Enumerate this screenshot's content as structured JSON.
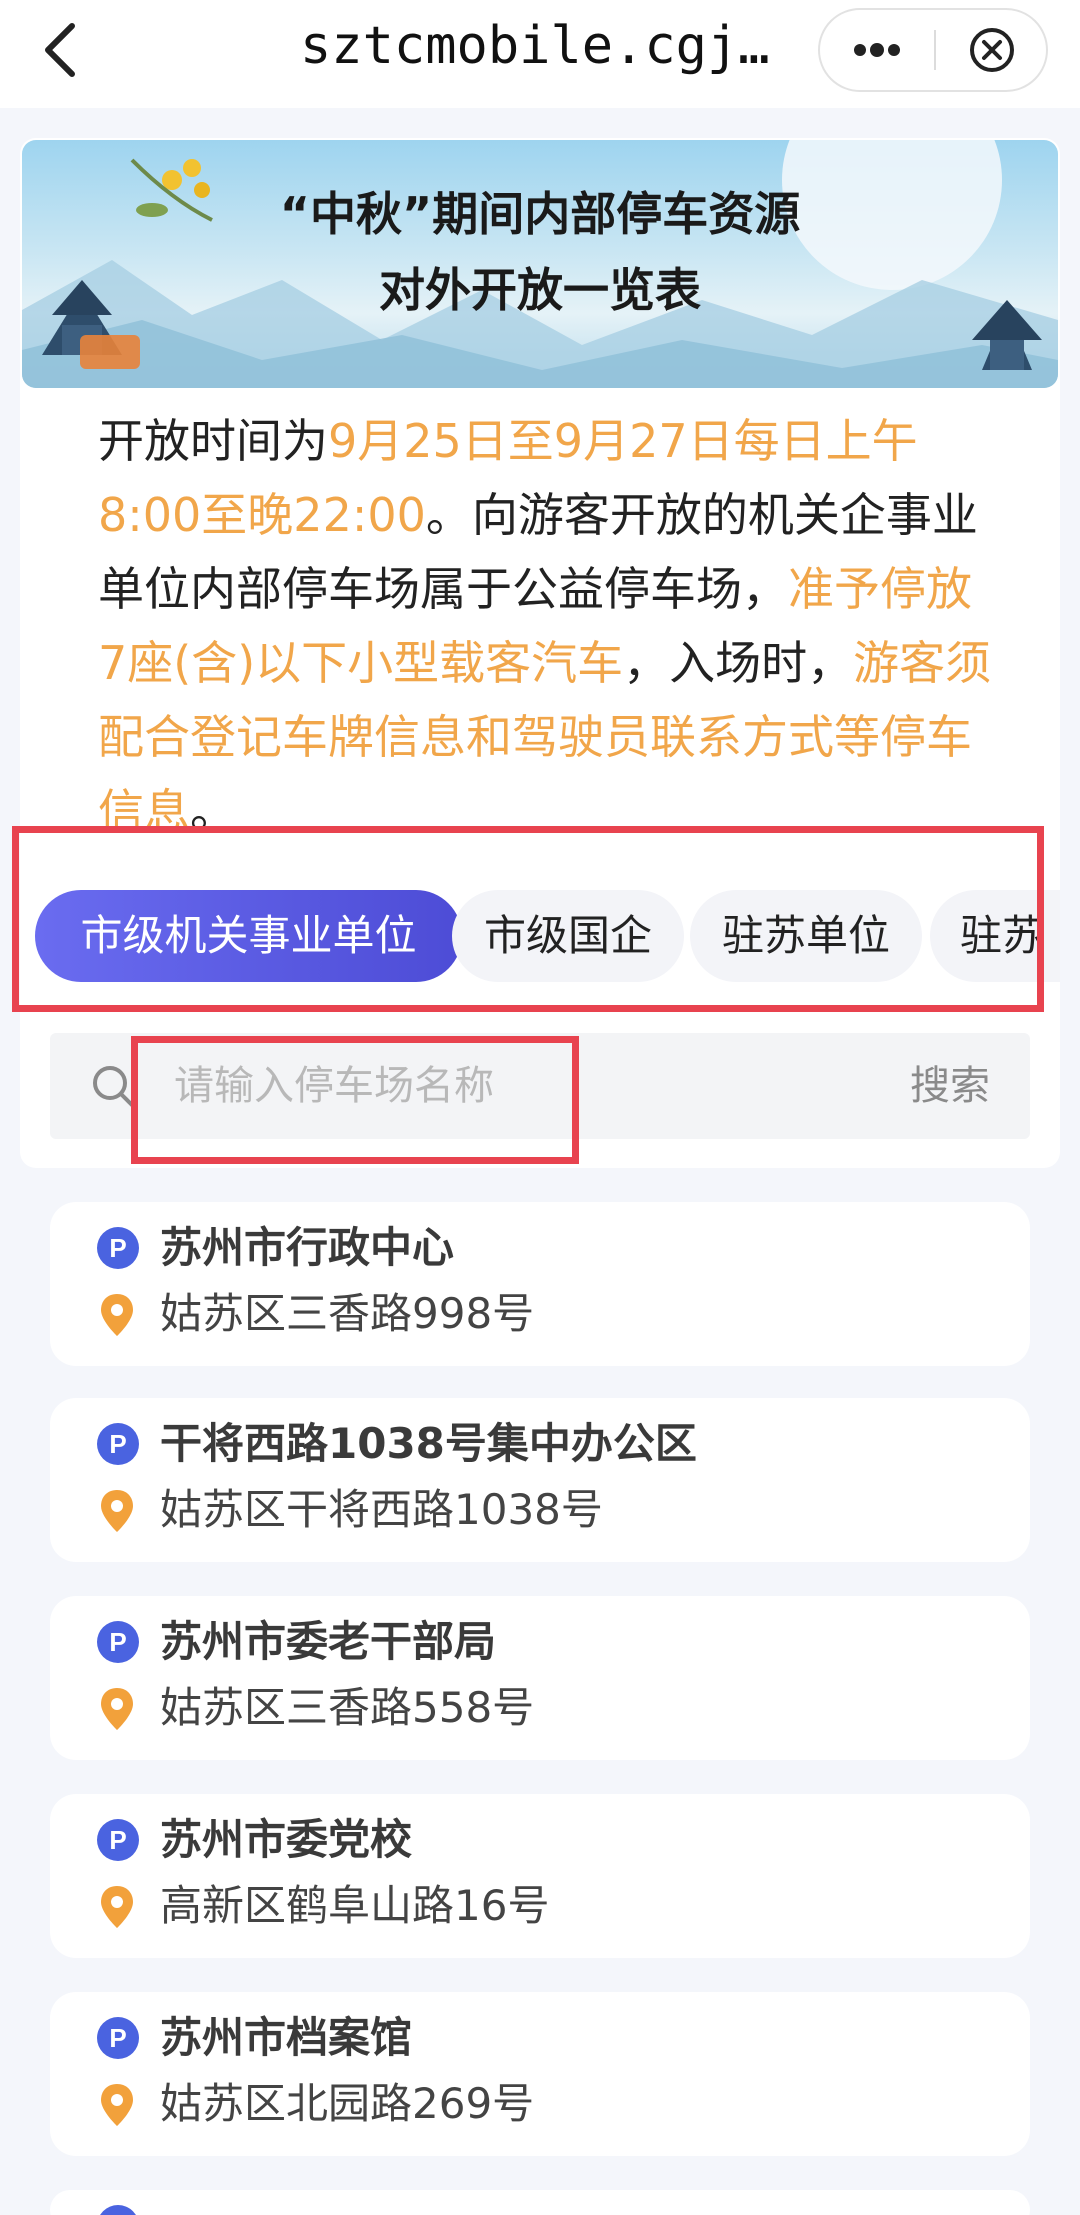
{
  "topbar": {
    "url_title": "sztcmobile.cgj…",
    "back_icon": "chevron-left-icon",
    "more_icon": "more-dots-icon",
    "close_icon": "close-circle-icon"
  },
  "banner": {
    "title_line1": "“中秋”期间内部停车资源",
    "title_line2": "对外开放一览表"
  },
  "intro": {
    "part1": "开放时间为",
    "part2": "9月25日至9月27日每日上午8:00至晚22:00",
    "part3": "。向游客开放的机关企事业单位内部停车场属于公益停车场，",
    "part4": "准予停放7座(含)以下小型载客汽车",
    "part5": "，入场时，",
    "part6": "游客须配合登记车牌信息和驾驶员联系方式等停车信息",
    "part7": "。"
  },
  "tabs": [
    {
      "label": "市级机关事业单位",
      "active": true
    },
    {
      "label": "市级国企",
      "active": false
    },
    {
      "label": "驻苏单位",
      "active": false
    },
    {
      "label": "驻苏",
      "active": false
    }
  ],
  "search": {
    "placeholder": "请输入停车场名称",
    "button_label": "搜索"
  },
  "parking_list": [
    {
      "name": "苏州市行政中心",
      "address": "姑苏区三香路998号"
    },
    {
      "name": "干将西路1038号集中办公区",
      "address": "姑苏区干将西路1038号"
    },
    {
      "name": "苏州市委老干部局",
      "address": "姑苏区三香路558号"
    },
    {
      "name": "苏州市委党校",
      "address": "高新区鹤阜山路16号"
    },
    {
      "name": "苏州市档案馆",
      "address": "姑苏区北园路269号"
    }
  ],
  "colors": {
    "accent_tab": "#5a5ae4",
    "highlight_text": "#f1a64a",
    "annotation_red": "#e8434f",
    "page_bg": "#f4f6fb"
  }
}
